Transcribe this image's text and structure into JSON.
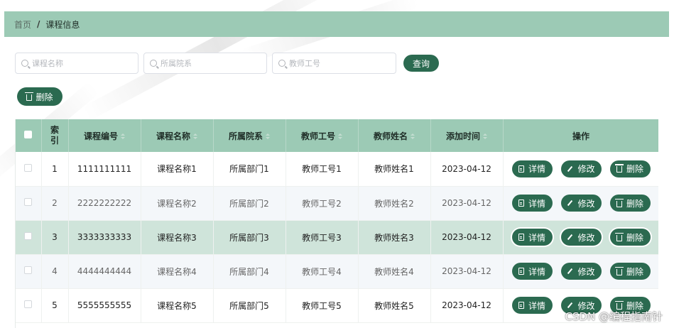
{
  "breadcrumb": {
    "home": "首页",
    "separator": "/",
    "current": "课程信息"
  },
  "search": {
    "course_name_placeholder": "课程名称",
    "department_placeholder": "所属院系",
    "teacher_id_placeholder": "教师工号",
    "query_label": "查询"
  },
  "toolbar": {
    "delete_label": "删除"
  },
  "table": {
    "headers": {
      "index": "索引",
      "course_code": "课程编号",
      "course_name": "课程名称",
      "department": "所属院系",
      "teacher_id": "教师工号",
      "teacher_name": "教师姓名",
      "added_time": "添加时间",
      "actions": "操作"
    },
    "rows": [
      {
        "index": "1",
        "course_code": "1111111111",
        "course_name": "课程名称1",
        "department": "所属部门1",
        "teacher_id": "教师工号1",
        "teacher_name": "教师姓名1",
        "added_time": "2023-04-12"
      },
      {
        "index": "2",
        "course_code": "2222222222",
        "course_name": "课程名称2",
        "department": "所属部门2",
        "teacher_id": "教师工号2",
        "teacher_name": "教师姓名2",
        "added_time": "2023-04-12"
      },
      {
        "index": "3",
        "course_code": "3333333333",
        "course_name": "课程名称3",
        "department": "所属部门3",
        "teacher_id": "教师工号3",
        "teacher_name": "教师姓名3",
        "added_time": "2023-04-12"
      },
      {
        "index": "4",
        "course_code": "4444444444",
        "course_name": "课程名称4",
        "department": "所属部门4",
        "teacher_id": "教师工号4",
        "teacher_name": "教师姓名4",
        "added_time": "2023-04-12"
      },
      {
        "index": "5",
        "course_code": "5555555555",
        "course_name": "课程名称5",
        "department": "所属部门5",
        "teacher_id": "教师工号5",
        "teacher_name": "教师姓名5",
        "added_time": "2023-04-12"
      }
    ],
    "actions": {
      "detail": "详情",
      "edit": "修改",
      "delete": "删除"
    }
  },
  "watermark": "CSDN @编程指南针",
  "colors": {
    "header_green": "#9ccab5",
    "button_green": "#2b6a50",
    "row_hover": "#cfe4da",
    "row_stripe": "#f4f7fa"
  }
}
